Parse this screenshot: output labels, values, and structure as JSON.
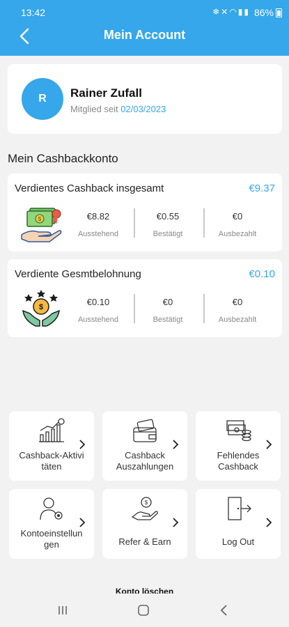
{
  "status_bar": {
    "time": "13:42",
    "icons": [
      "snowflake-icon",
      "mute-icon",
      "wifi-icon",
      "signal-icon",
      "signal-icon"
    ],
    "battery": "86%"
  },
  "header": {
    "title": "Mein Account",
    "background": "#35a7ea"
  },
  "profile": {
    "initial": "R",
    "name": "Rainer Zufall",
    "member_label": "Mitglied seit",
    "member_date": "02/03/2023"
  },
  "cashback_section": {
    "title": "Mein Cashbackkonto"
  },
  "cards": [
    {
      "title": "Verdientes Cashback insgesamt",
      "total": "€9.37",
      "icon": "money-hand-icon",
      "stats": [
        {
          "value": "€8.82",
          "label": "Ausstehend"
        },
        {
          "value": "€0.55",
          "label": "Bestätigt"
        },
        {
          "value": "€0",
          "label": "Ausbezahlt"
        }
      ]
    },
    {
      "title": "Verdiente Gesmtbelohnung",
      "total": "€0.10",
      "icon": "coin-hands-icon",
      "stats": [
        {
          "value": "€0.10",
          "label": "Ausstehend"
        },
        {
          "value": "€0",
          "label": "Bestätigt"
        },
        {
          "value": "€0",
          "label": "Ausbezahlt"
        }
      ]
    }
  ],
  "tiles": [
    {
      "label": "Cashback-Aktivitäten",
      "line1": "Cashback-Aktivi",
      "line2": "täten",
      "icon": "chart-icon"
    },
    {
      "label": "Cashback Auszahlungen",
      "line1": "Cashback",
      "line2": "Auszahlungen",
      "icon": "wallet-cards-icon"
    },
    {
      "label": "Fehlendes Cashback",
      "line1": "Fehlendes",
      "line2": "Cashback",
      "icon": "cash-coins-icon"
    },
    {
      "label": "Kontoeinstellungen",
      "line1": "Kontoeinstellun",
      "line2": "gen",
      "icon": "user-settings-icon"
    },
    {
      "label": "Refer & Earn",
      "line1": "Refer & Earn",
      "icon": "hand-coin-icon"
    },
    {
      "label": "Log Out",
      "line1": "Log Out",
      "icon": "logout-door-icon"
    }
  ],
  "footer": {
    "delete_account": "Konto löschen"
  },
  "nav_bar": {
    "buttons": [
      "recent-apps-icon",
      "home-icon",
      "back-icon"
    ]
  },
  "colors": {
    "accent": "#35a7ea",
    "background": "#f2f2f2",
    "card": "#ffffff"
  }
}
